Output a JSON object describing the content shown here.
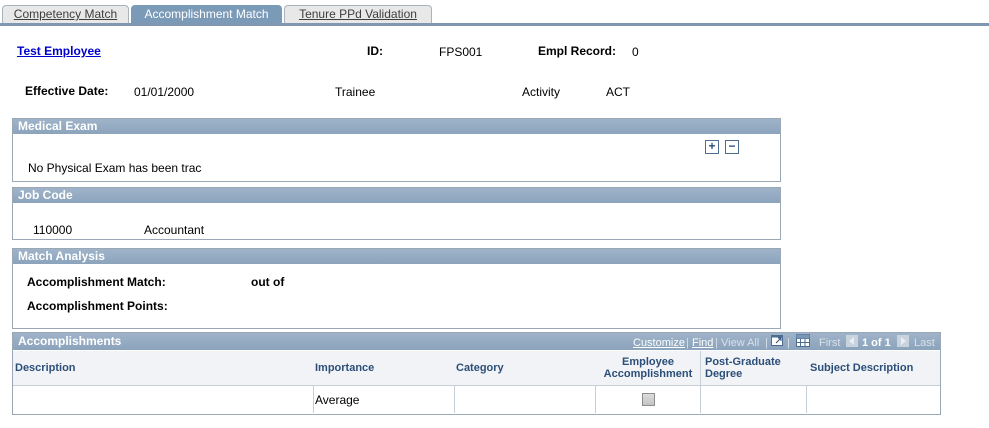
{
  "tabs": [
    {
      "label": "Competency Match"
    },
    {
      "label": "Accomplishment Match"
    },
    {
      "label": "Tenure PPd Validation"
    }
  ],
  "employee": {
    "name": "Test Employee",
    "id_label": "ID:",
    "id_value": "FPS001",
    "empl_record_label": "Empl Record:",
    "empl_record_value": "0",
    "effective_date_label": "Effective Date:",
    "effective_date_value": "01/01/2000",
    "status_value": "Trainee",
    "activity_label": "Activity",
    "activity_value": "ACT"
  },
  "medical_exam": {
    "title": "Medical Exam",
    "text": "No Physical Exam has been trac",
    "add_symbol": "+",
    "remove_symbol": "−"
  },
  "job_code": {
    "title": "Job Code",
    "code": "110000",
    "description": "Accountant"
  },
  "match_analysis": {
    "title": "Match Analysis",
    "match_label": "Accomplishment Match:",
    "out_of": "out of",
    "points_label": "Accomplishment Points:"
  },
  "accomplishments": {
    "title": "Accomplishments",
    "nav": {
      "customize": "Customize",
      "find": "Find",
      "view_all": "View All",
      "first": "First",
      "range": "1 of 1",
      "last": "Last"
    },
    "columns": [
      "Description",
      "Importance",
      "Category",
      "Employee Accomplishment",
      "Post-Graduate Degree",
      "Subject Description"
    ],
    "rows": [
      {
        "description": "",
        "importance": "Average",
        "category": "",
        "employee_accomplishment": false,
        "post_graduate_degree": "",
        "subject_description": ""
      }
    ]
  }
}
